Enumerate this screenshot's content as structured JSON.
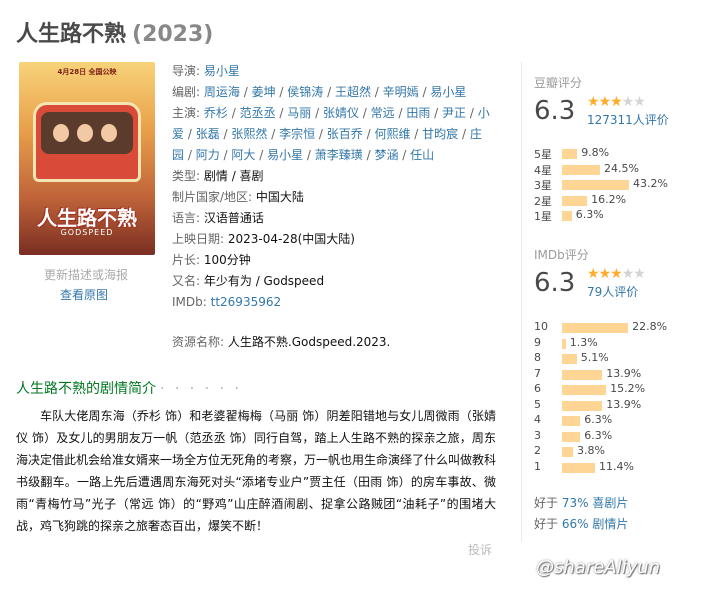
{
  "title": "人生路不熟",
  "year": "(2023)",
  "poster": {
    "date_text": "4月28日 全国公映",
    "title_text": "人生路不熟",
    "sub_text": "GODSPEED",
    "update_link": "更新描述或海报",
    "view_original": "查看原图"
  },
  "info": {
    "director_label": "导演:",
    "director": "易小星",
    "writers_label": "编剧:",
    "writers": [
      "周运海",
      "姜坤",
      "侯锦涛",
      "王超然",
      "辛明嫣",
      "易小星"
    ],
    "cast_label": "主演:",
    "cast_line1": [
      "乔杉",
      "范丞丞",
      "马丽",
      "张婧仪",
      "常远",
      "田雨",
      "尹正",
      "小"
    ],
    "cast_line2": [
      "爱",
      "张磊",
      "张熙然",
      "李宗恒",
      "张百乔",
      "何熙维",
      "甘昀宸",
      "庄"
    ],
    "cast_line3": [
      "园",
      "阿力",
      "阿大",
      "易小星",
      "萧李臻璜",
      "梦涵",
      "任山"
    ],
    "genre_label": "类型:",
    "genre": "剧情 / 喜剧",
    "country_label": "制片国家/地区:",
    "country": "中国大陆",
    "language_label": "语言:",
    "language": "汉语普通话",
    "release_label": "上映日期:",
    "release": "2023-04-28(中国大陆)",
    "runtime_label": "片长:",
    "runtime": "100分钟",
    "aka_label": "又名:",
    "aka": "年少有为 / Godspeed",
    "imdb_label": "IMDb:",
    "imdb": "tt26935962"
  },
  "resource": {
    "label": "资源名称:",
    "value": "人生路不熟.Godspeed.2023."
  },
  "synopsis": {
    "heading": "人生路不熟的剧情简介",
    "dots": "· · · · · ·",
    "text": "车队大佬周东海（乔杉 饰）和老婆翟梅梅（马丽 饰）阴差阳错地与女儿周微雨（张婧仪 饰）及女儿的男朋友万一帆（范丞丞 饰）同行自驾，踏上人生路不熟的探亲之旅，周东海决定借此机会给准女婿来一场全方位无死角的考察，万一帆也用生命演绎了什么叫做教科书级翻车。一路上先后遭遇周东海死对头“添堵专业户”贾主任（田雨 饰）的房车事故、微雨“青梅竹马”光子（常远 饰）的“野鸡”山庄醉酒闹剧、捉拿公路贼团“油耗子”的围堵大战，鸡飞狗跳的探亲之旅奢态百出，爆笑不断！",
    "report": "投诉"
  },
  "douban": {
    "label": "豆瓣评分",
    "score": "6.3",
    "stars": 3,
    "votes": "127311人评价",
    "dist": [
      {
        "k": "5星",
        "p": "9.8%",
        "v": 9.8
      },
      {
        "k": "4星",
        "p": "24.5%",
        "v": 24.5
      },
      {
        "k": "3星",
        "p": "43.2%",
        "v": 43.2
      },
      {
        "k": "2星",
        "p": "16.2%",
        "v": 16.2
      },
      {
        "k": "1星",
        "p": "6.3%",
        "v": 6.3
      }
    ]
  },
  "imdb_rating": {
    "label": "IMDb评分",
    "score": "6.3",
    "stars": 3,
    "votes": "79人评价",
    "dist": [
      {
        "k": "10",
        "p": "22.8%",
        "v": 22.8
      },
      {
        "k": "9",
        "p": "1.3%",
        "v": 1.3
      },
      {
        "k": "8",
        "p": "5.1%",
        "v": 5.1
      },
      {
        "k": "7",
        "p": "13.9%",
        "v": 13.9
      },
      {
        "k": "6",
        "p": "15.2%",
        "v": 15.2
      },
      {
        "k": "5",
        "p": "13.9%",
        "v": 13.9
      },
      {
        "k": "4",
        "p": "6.3%",
        "v": 6.3
      },
      {
        "k": "3",
        "p": "6.3%",
        "v": 6.3
      },
      {
        "k": "2",
        "p": "3.8%",
        "v": 3.8
      },
      {
        "k": "1",
        "p": "11.4%",
        "v": 11.4
      }
    ]
  },
  "better_than": [
    {
      "pre": "好于 ",
      "pct": "73%",
      "genre": "喜剧片"
    },
    {
      "pre": "好于 ",
      "pct": "66%",
      "genre": "剧情片"
    }
  ],
  "watermark": "@shareAliyun",
  "colors": {
    "link": "#3377aa",
    "star": "#ffac2d",
    "bar": "#ffd596",
    "heading": "#007722"
  }
}
